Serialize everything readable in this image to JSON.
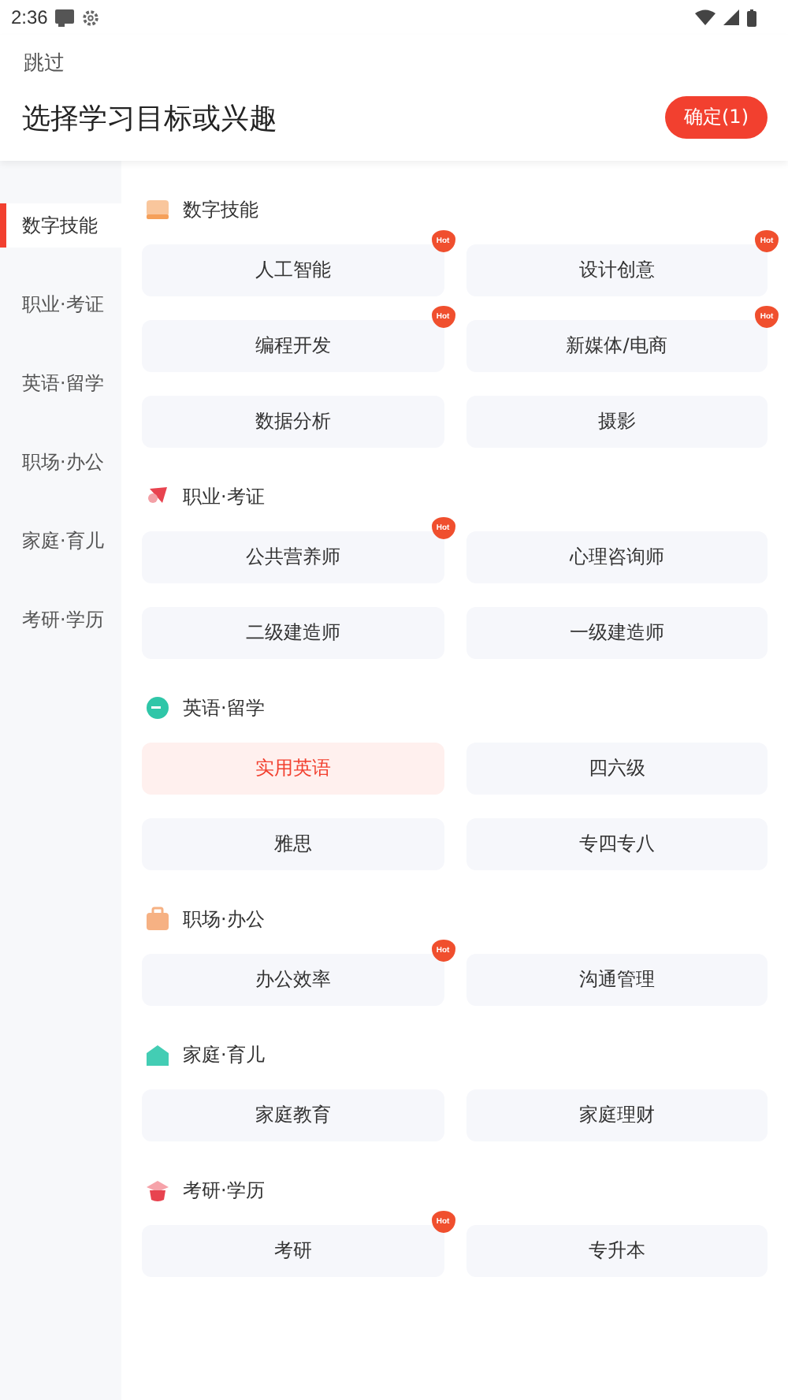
{
  "status_bar": {
    "time": "2:36"
  },
  "skip": "跳过",
  "title": "选择学习目标或兴趣",
  "confirm_button": "确定(1)",
  "sidebar": {
    "items": [
      {
        "label": "数字技能",
        "selected": true
      },
      {
        "label": "职业·考证",
        "selected": false
      },
      {
        "label": "英语·留学",
        "selected": false
      },
      {
        "label": "职场·办公",
        "selected": false
      },
      {
        "label": "家庭·育儿",
        "selected": false
      },
      {
        "label": "考研·学历",
        "selected": false
      }
    ]
  },
  "sections": [
    {
      "title": "数字技能",
      "items": [
        {
          "label": "人工智能",
          "selected": false,
          "badge": "Hot"
        },
        {
          "label": "设计创意",
          "selected": false,
          "badge": "Hot"
        },
        {
          "label": "编程开发",
          "selected": false,
          "badge": "Hot"
        },
        {
          "label": "新媒体/电商",
          "selected": false,
          "badge": "Hot"
        },
        {
          "label": "数据分析",
          "selected": false
        },
        {
          "label": "摄影",
          "selected": false
        }
      ]
    },
    {
      "title": "职业·考证",
      "items": [
        {
          "label": "公共营养师",
          "selected": false,
          "badge": "Hot"
        },
        {
          "label": "心理咨询师",
          "selected": false
        },
        {
          "label": "二级建造师",
          "selected": false
        },
        {
          "label": "一级建造师",
          "selected": false
        }
      ]
    },
    {
      "title": "英语·留学",
      "items": [
        {
          "label": "实用英语",
          "selected": true
        },
        {
          "label": "四六级",
          "selected": false
        },
        {
          "label": "雅思",
          "selected": false
        },
        {
          "label": "专四专八",
          "selected": false
        }
      ]
    },
    {
      "title": "职场·办公",
      "items": [
        {
          "label": "办公效率",
          "selected": false,
          "badge": "Hot"
        },
        {
          "label": "沟通管理",
          "selected": false
        }
      ]
    },
    {
      "title": "家庭·育儿",
      "items": [
        {
          "label": "家庭教育",
          "selected": false
        },
        {
          "label": "家庭理财",
          "selected": false
        }
      ]
    },
    {
      "title": "考研·学历",
      "items": [
        {
          "label": "考研",
          "selected": false,
          "badge": "Hot"
        },
        {
          "label": "专升本",
          "selected": false
        }
      ]
    }
  ]
}
